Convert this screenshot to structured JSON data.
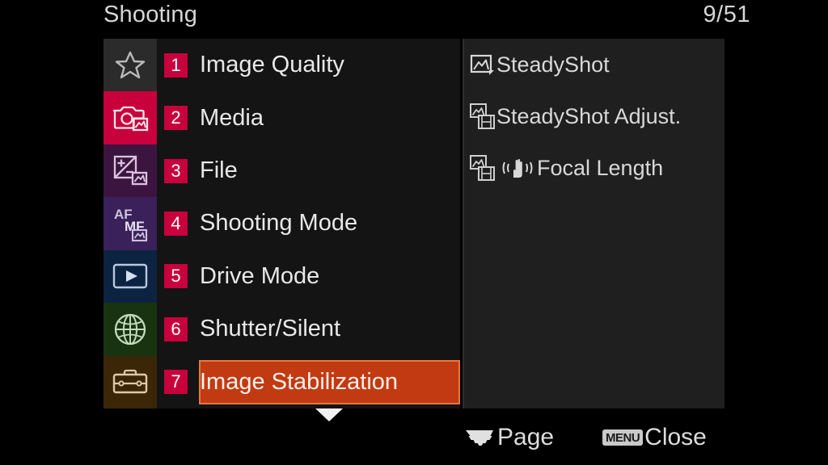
{
  "header": {
    "title": "Shooting",
    "page_indicator": "9/51"
  },
  "tabs": [
    {
      "name": "favorites",
      "icon": "star-icon",
      "bg": "#2b2b2b",
      "stroke": "#b9b9b9"
    },
    {
      "name": "shooting",
      "icon": "camera-icon",
      "bg": "#c8003c",
      "stroke": "#ffe5ec"
    },
    {
      "name": "exposure",
      "icon": "exposure-icon",
      "bg": "#3c1440",
      "stroke": "#d9c3dd"
    },
    {
      "name": "focus",
      "icon": "af-mf-icon",
      "bg": "#3a2159",
      "stroke": "#cdc2e0",
      "text_top": "AF",
      "text_bottom": "MF"
    },
    {
      "name": "playback",
      "icon": "playback-icon",
      "bg": "#0d2342",
      "stroke": "#b9c8dd"
    },
    {
      "name": "network",
      "icon": "globe-icon",
      "bg": "#17330f",
      "stroke": "#c4d8bb"
    },
    {
      "name": "setup",
      "icon": "toolbox-icon",
      "bg": "#3b2608",
      "stroke": "#ddc9a6"
    }
  ],
  "menu": {
    "items": [
      {
        "number": "1",
        "label": "Image Quality",
        "selected": false
      },
      {
        "number": "2",
        "label": "Media",
        "selected": false
      },
      {
        "number": "3",
        "label": "File",
        "selected": false
      },
      {
        "number": "4",
        "label": "Shooting Mode",
        "selected": false
      },
      {
        "number": "5",
        "label": "Drive Mode",
        "selected": false
      },
      {
        "number": "6",
        "label": "Shutter/Silent",
        "selected": false
      },
      {
        "number": "7",
        "label": "Image Stabilization",
        "selected": true
      }
    ],
    "badge_color": "#c8003c",
    "highlight_color": "#c23a12",
    "highlight_border_color": "#e8763f"
  },
  "sub_panel": {
    "items": [
      {
        "label": "SteadyShot",
        "icon": "photo-icon"
      },
      {
        "label": "SteadyShot Adjust.",
        "icon": "photo-movie-icon"
      },
      {
        "label": "Focal Length",
        "icon": "photo-movie-icon",
        "extra_icon": "hand-shake-icon"
      }
    ]
  },
  "bottom_bar": {
    "page": {
      "label": "Page",
      "icon": "control-wheel-icon"
    },
    "close": {
      "label": "Close",
      "badge": "MENU"
    }
  }
}
